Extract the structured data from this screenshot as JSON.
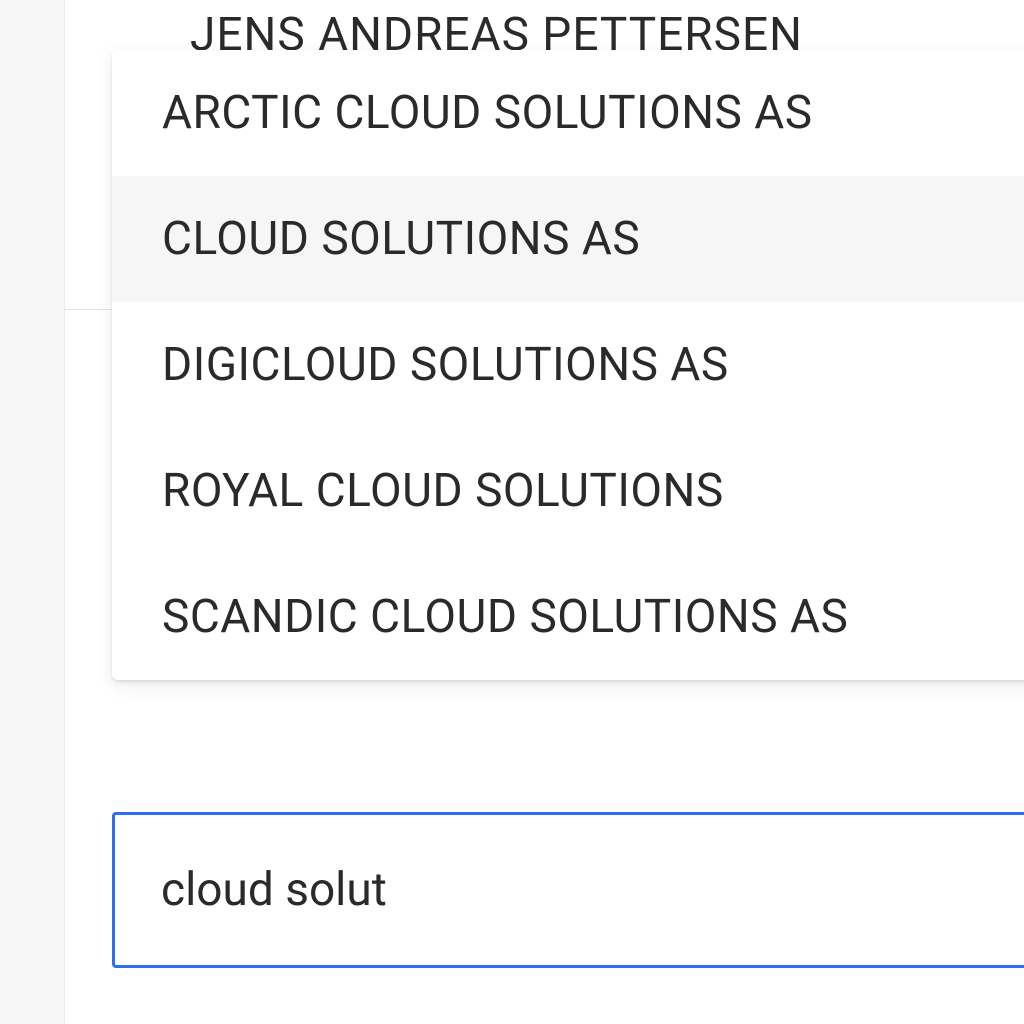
{
  "background": {
    "name": "JENS ANDREAS PETTERSEN"
  },
  "dropdown": {
    "items": [
      {
        "label": "ARCTIC CLOUD SOLUTIONS AS",
        "highlighted": false
      },
      {
        "label": "CLOUD SOLUTIONS AS",
        "highlighted": true
      },
      {
        "label": "DIGICLOUD SOLUTIONS AS",
        "highlighted": false
      },
      {
        "label": "ROYAL CLOUD SOLUTIONS",
        "highlighted": false
      },
      {
        "label": "SCANDIC CLOUD SOLUTIONS AS",
        "highlighted": false
      }
    ]
  },
  "search": {
    "value": "cloud solut"
  }
}
